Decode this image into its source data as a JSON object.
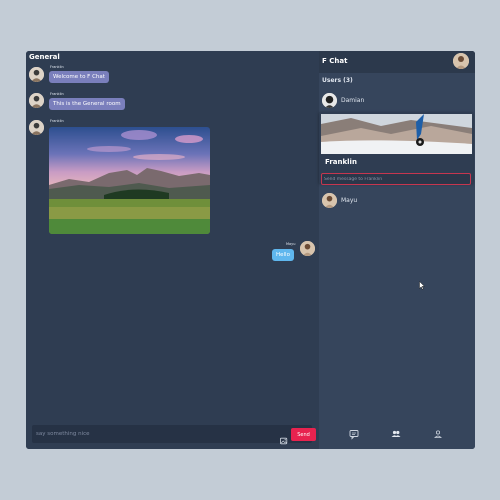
{
  "room": {
    "title": "General"
  },
  "messages": [
    {
      "sender": "Franklin",
      "text": "Welcome to F Chat",
      "direction": "in"
    },
    {
      "sender": "Franklin",
      "text": "This is the General room",
      "direction": "in"
    },
    {
      "sender": "Franklin",
      "type": "image",
      "image": "mountain-meadow-photo",
      "direction": "in"
    },
    {
      "sender": "Mayu",
      "text": "Hello",
      "direction": "out"
    }
  ],
  "composer": {
    "placeholder": "say something nice",
    "send_label": "Send",
    "image_icon": "image-upload-icon"
  },
  "sidebar": {
    "brand": "F Chat",
    "users_label": "Users (3)",
    "users": [
      {
        "name": "Damian",
        "avatar": "damian-avatar"
      },
      {
        "name": "Franklin",
        "avatar": "franklin-avatar",
        "expanded": true,
        "cover": "snowy-mountain-cover",
        "dm_placeholder": "Send message to Franklin"
      },
      {
        "name": "Mayu",
        "avatar": "mayu-avatar"
      }
    ],
    "nav": [
      {
        "icon": "chat-icon"
      },
      {
        "icon": "users-icon"
      },
      {
        "icon": "user-profile-icon"
      }
    ]
  },
  "colors": {
    "page_background": "#c3ccd6",
    "app_background": "#2f3d52",
    "side_panel": "#36455c",
    "incoming_bubble": "#7a7fbc",
    "outgoing_bubble": "#5fb7ee",
    "send_button": "#e8234f",
    "input_focus_border": "#c6364f"
  }
}
